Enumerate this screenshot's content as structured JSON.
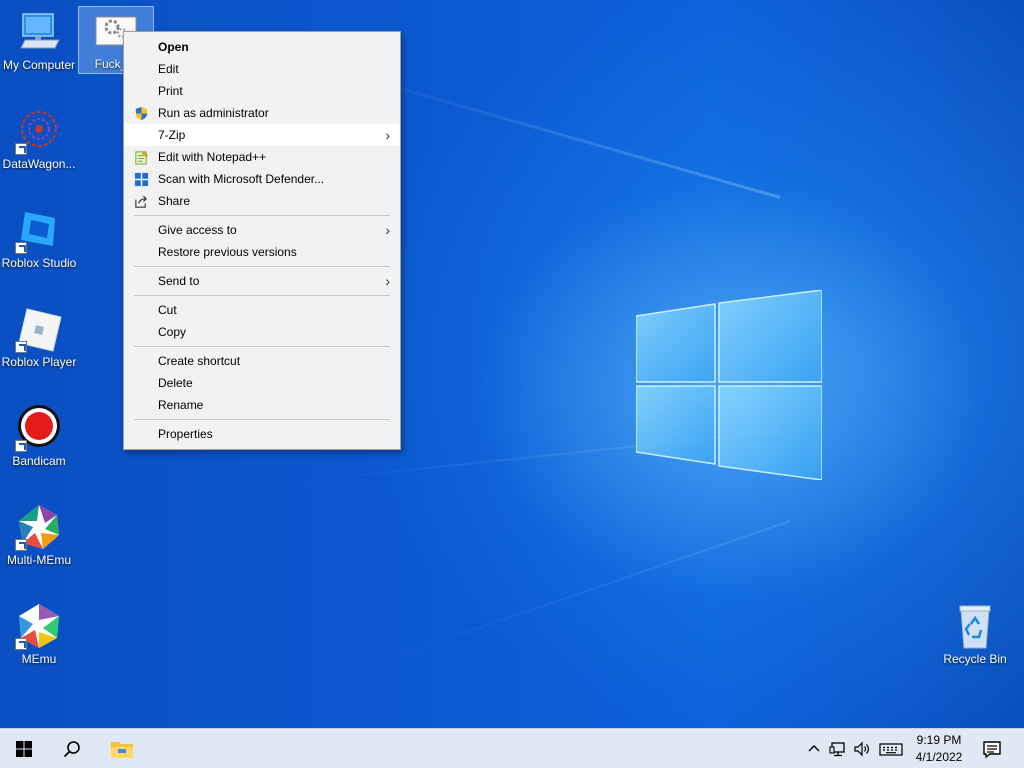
{
  "desktop_icons": [
    {
      "label": "My Computer"
    },
    {
      "label": "Fuck_..."
    },
    {
      "label": "DataWagon..."
    },
    {
      "label": "Roblox Studio"
    },
    {
      "label": "Roblox Player"
    },
    {
      "label": "Bandicam"
    },
    {
      "label": "Multi-MEmu"
    },
    {
      "label": "MEmu"
    },
    {
      "label": "Recycle Bin"
    }
  ],
  "context_menu": {
    "open": "Open",
    "edit": "Edit",
    "print": "Print",
    "run_as_admin": "Run as administrator",
    "seven_zip": "7-Zip",
    "edit_notepadpp": "Edit with Notepad++",
    "scan_defender": "Scan with Microsoft Defender...",
    "share": "Share",
    "give_access": "Give access to",
    "restore_versions": "Restore previous versions",
    "send_to": "Send to",
    "cut": "Cut",
    "copy": "Copy",
    "create_shortcut": "Create shortcut",
    "delete": "Delete",
    "rename": "Rename",
    "properties": "Properties",
    "submenu_arrow": "›"
  },
  "taskbar": {
    "time": "9:19 PM",
    "date": "4/1/2022"
  },
  "colors": {
    "accent": "#0b5ad1",
    "menu_bg": "#f2f2f2",
    "taskbar_bg": "#dfe8f3"
  }
}
